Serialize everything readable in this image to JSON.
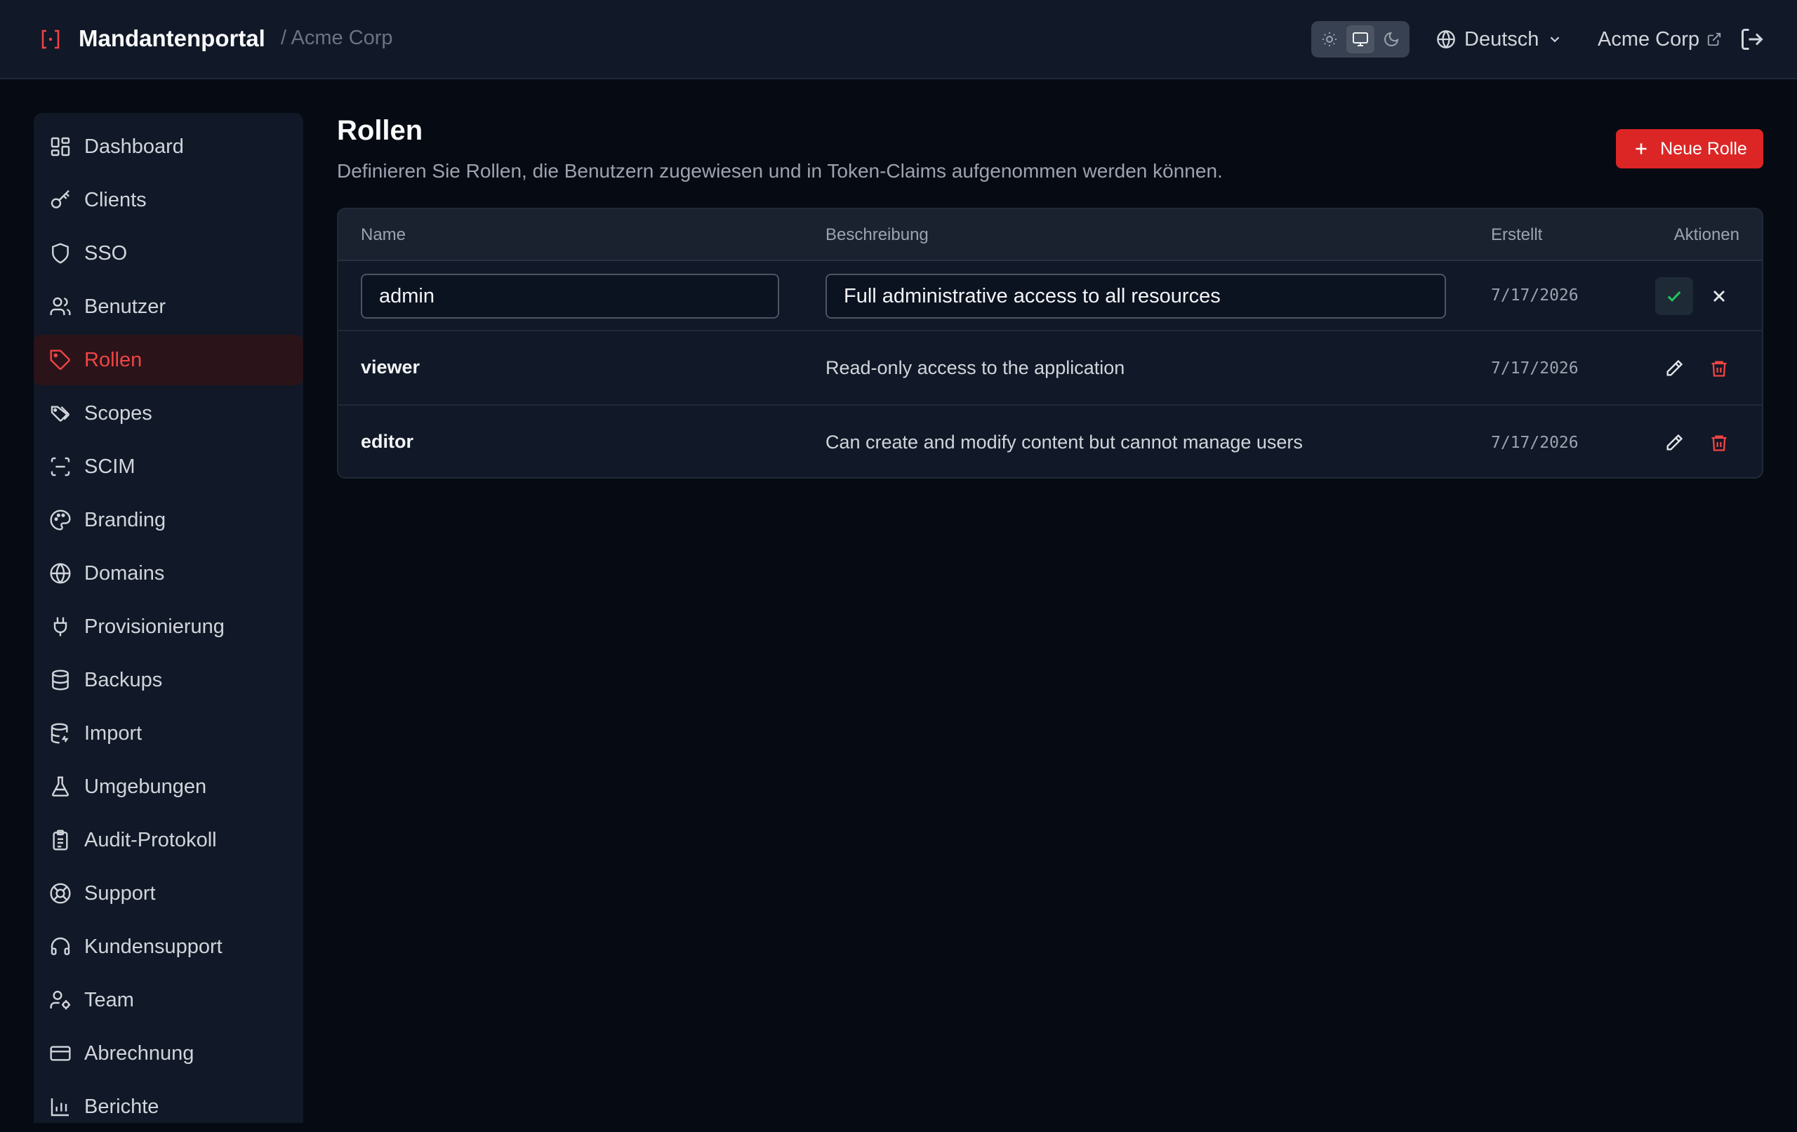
{
  "header": {
    "app_title": "Mandantenportal",
    "tenant_breadcrumb": "/ Acme Corp",
    "language": "Deutsch",
    "tenant_link": "Acme Corp",
    "theme_options": [
      "sun-icon",
      "monitor-icon",
      "moon-icon"
    ],
    "active_theme": "system"
  },
  "sidebar": {
    "items": [
      {
        "label": "Dashboard",
        "icon": "dashboard-icon"
      },
      {
        "label": "Clients",
        "icon": "key-icon"
      },
      {
        "label": "SSO",
        "icon": "shield-icon"
      },
      {
        "label": "Benutzer",
        "icon": "users-icon"
      },
      {
        "label": "Rollen",
        "icon": "tag-icon",
        "active": true
      },
      {
        "label": "Scopes",
        "icon": "tags-icon"
      },
      {
        "label": "SCIM",
        "icon": "scan-icon"
      },
      {
        "label": "Branding",
        "icon": "palette-icon"
      },
      {
        "label": "Domains",
        "icon": "globe-icon"
      },
      {
        "label": "Provisionierung",
        "icon": "plug-icon"
      },
      {
        "label": "Backups",
        "icon": "database-icon"
      },
      {
        "label": "Import",
        "icon": "database-import-icon"
      },
      {
        "label": "Umgebungen",
        "icon": "flask-icon"
      },
      {
        "label": "Audit-Protokoll",
        "icon": "clipboard-icon"
      },
      {
        "label": "Support",
        "icon": "lifebuoy-icon"
      },
      {
        "label": "Kundensupport",
        "icon": "headset-icon"
      },
      {
        "label": "Team",
        "icon": "user-cog-icon"
      },
      {
        "label": "Abrechnung",
        "icon": "credit-card-icon"
      },
      {
        "label": "Berichte",
        "icon": "bar-chart-icon"
      }
    ]
  },
  "main": {
    "title": "Rollen",
    "description": "Definieren Sie Rollen, die Benutzern zugewiesen und in Token-Claims aufgenommen werden können.",
    "new_button": "Neue Rolle",
    "table": {
      "columns": [
        "Name",
        "Beschreibung",
        "Erstellt",
        "Aktionen"
      ],
      "editing_row": {
        "name_value": "admin",
        "description_value": "Full administrative access to all resources",
        "created": "7/17/2026"
      },
      "rows": [
        {
          "name": "viewer",
          "description": "Read-only access to the application",
          "created": "7/17/2026"
        },
        {
          "name": "editor",
          "description": "Can create and modify content but cannot manage users",
          "created": "7/17/2026"
        }
      ]
    }
  },
  "colors": {
    "accent": "#dc2626",
    "active_nav_text": "#ef4444",
    "confirm": "#22c55e",
    "background": "#060a12",
    "panel": "#111827"
  }
}
